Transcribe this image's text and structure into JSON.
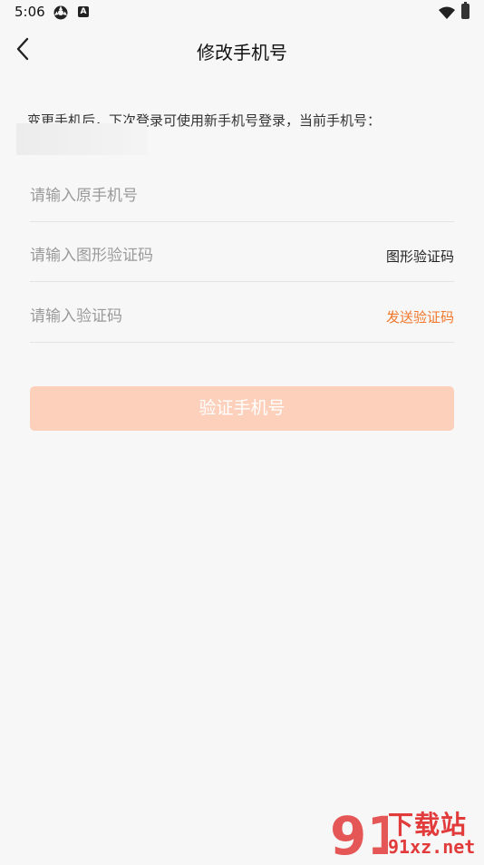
{
  "status_bar": {
    "time": "5:06",
    "badge_letter": "A"
  },
  "header": {
    "title": "修改手机号"
  },
  "form": {
    "hint": "变更手机后，下次登录可使用新手机号登录，当前手机号：",
    "old_phone_placeholder": "请输入原手机号",
    "captcha_placeholder": "请输入图形验证码",
    "captcha_label": "图形验证码",
    "sms_code_placeholder": "请输入验证码",
    "send_code_label": "发送验证码",
    "submit_label": "验证手机号"
  },
  "watermark": {
    "logo_text": "91",
    "name": "下载站",
    "domain": "91xz.net"
  },
  "colors": {
    "background": "#f7f7f7",
    "accent": "#f0772b",
    "button_disabled": "#fdd0bb",
    "watermark": "#e23b3b"
  }
}
